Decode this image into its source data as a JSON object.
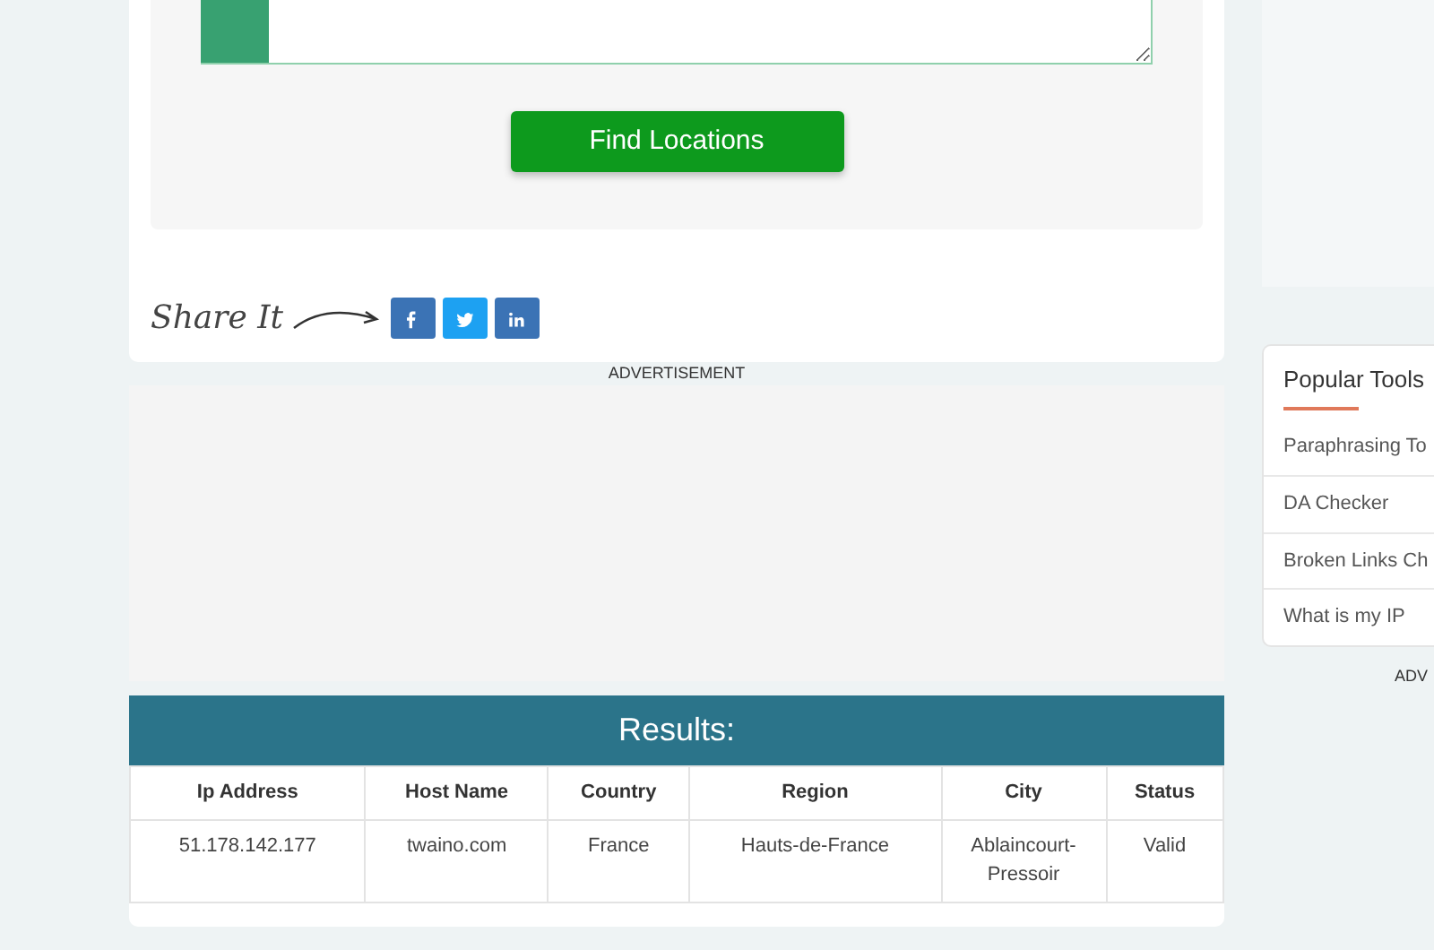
{
  "form": {
    "submit_button": "Find Locations"
  },
  "share": {
    "label": "Share It",
    "buttons": [
      {
        "kind": "facebook",
        "color": "#3b73b5"
      },
      {
        "kind": "twitter",
        "color": "#1da1f2"
      },
      {
        "kind": "linkedin",
        "color": "#3b73b5"
      }
    ]
  },
  "advertisement_label": "ADVERTISEMENT",
  "results": {
    "title": "Results:",
    "columns": [
      "Ip Address",
      "Host Name",
      "Country",
      "Region",
      "City",
      "Status"
    ],
    "rows": [
      [
        "51.178.142.177",
        "twaino.com",
        "France",
        "Hauts-de-France",
        "Ablaincourt-Pressoir",
        "Valid"
      ]
    ]
  },
  "sidebar": {
    "title": "Popular Tools",
    "items": [
      "Paraphrasing To",
      "DA Checker",
      "Broken Links Ch",
      "What is my IP"
    ],
    "advertisement_label": "ADV"
  }
}
